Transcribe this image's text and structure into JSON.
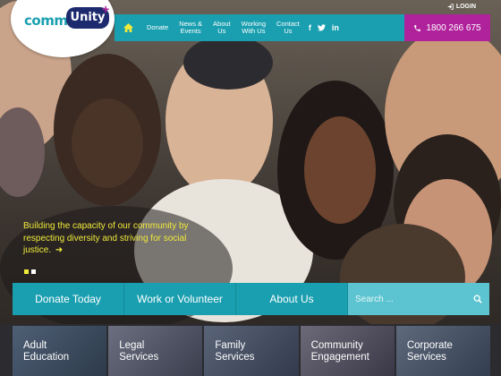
{
  "logo": {
    "part1": "comm",
    "part2": "Unity",
    "plus": "+"
  },
  "header": {
    "login_label": "LOGIN",
    "phone": "1800 266 675",
    "nav": [
      {
        "label": "Donate"
      },
      {
        "label": "News &\nEvents"
      },
      {
        "label": "About\nUs"
      },
      {
        "label": "Working\nWith Us"
      },
      {
        "label": "Contact\nUs"
      }
    ],
    "social": {
      "facebook": "f",
      "twitter": "t",
      "linkedin": "in"
    }
  },
  "hero": {
    "tagline": "Building the capacity of our community by respecting diversity and striving for social justice.",
    "arrow": "➜"
  },
  "actions": {
    "donate": "Donate Today",
    "work": "Work or Volunteer",
    "about": "About Us",
    "search_placeholder": "Search ..."
  },
  "services": [
    {
      "label": "Adult\nEducation"
    },
    {
      "label": "Legal\nServices"
    },
    {
      "label": "Family\nServices"
    },
    {
      "label": "Community\nEngagement"
    },
    {
      "label": "Corporate\nServices"
    }
  ],
  "colors": {
    "teal": "#1a9fb0",
    "magenta": "#b0229c",
    "yellow": "#f0ea3a",
    "navy": "#1d2a6e"
  }
}
